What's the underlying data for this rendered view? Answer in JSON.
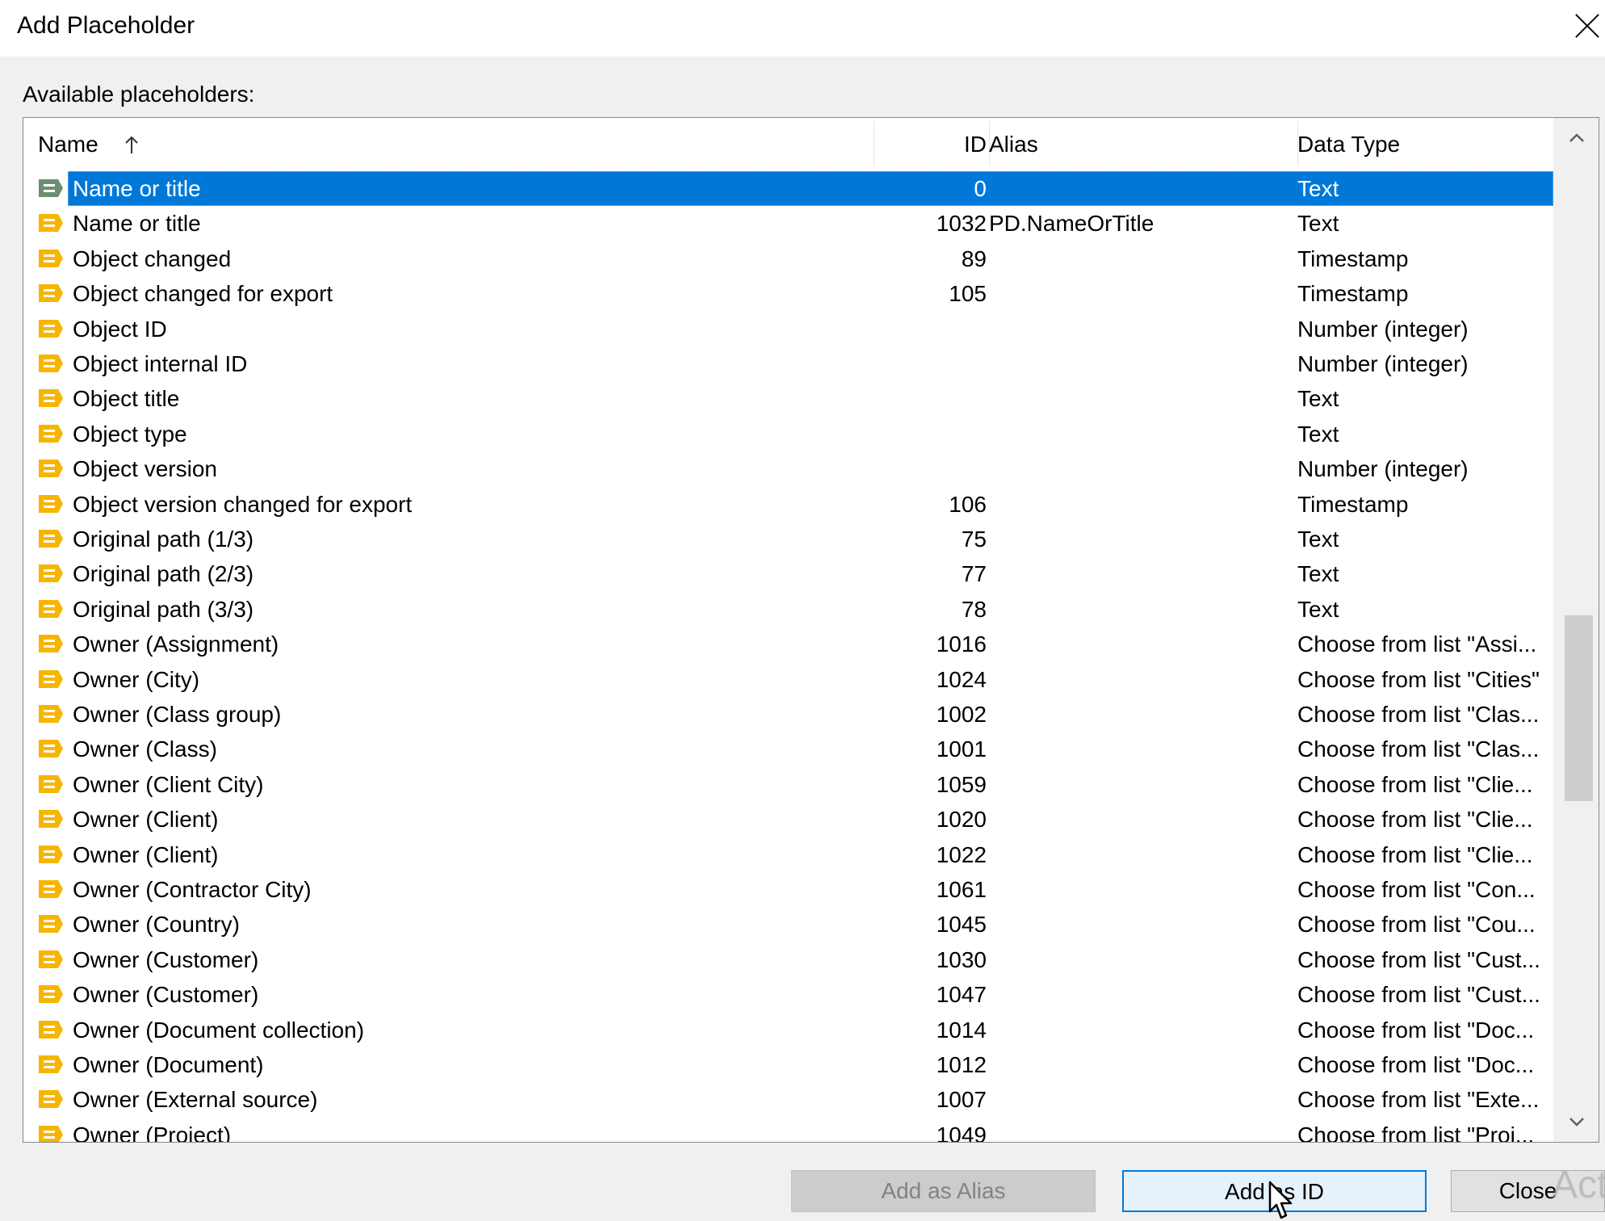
{
  "window": {
    "title": "Add Placeholder"
  },
  "section_label": "Available placeholders:",
  "columns": {
    "name": "Name",
    "id": "ID",
    "alias": "Alias",
    "data_type": "Data Type"
  },
  "icons": {
    "selected_row": "placeholder-grey-icon",
    "row": "placeholder-orange-icon",
    "sort": "sort-up-arrow-icon"
  },
  "colors": {
    "selection": "#0078d7",
    "icon_orange": "#f7b500",
    "icon_grey": "#6b8f70"
  },
  "rows": [
    {
      "name": "Name or title",
      "id": "0",
      "alias": "",
      "data_type": "Text",
      "selected": true
    },
    {
      "name": "Name or title",
      "id": "1032",
      "alias": "PD.NameOrTitle",
      "data_type": "Text"
    },
    {
      "name": "Object changed",
      "id": "89",
      "alias": "",
      "data_type": "Timestamp"
    },
    {
      "name": "Object changed for export",
      "id": "105",
      "alias": "",
      "data_type": "Timestamp"
    },
    {
      "name": "Object ID",
      "id": "",
      "alias": "",
      "data_type": "Number (integer)"
    },
    {
      "name": "Object internal ID",
      "id": "",
      "alias": "",
      "data_type": "Number (integer)"
    },
    {
      "name": "Object title",
      "id": "",
      "alias": "",
      "data_type": "Text"
    },
    {
      "name": "Object type",
      "id": "",
      "alias": "",
      "data_type": "Text"
    },
    {
      "name": "Object version",
      "id": "",
      "alias": "",
      "data_type": "Number (integer)"
    },
    {
      "name": "Object version changed for export",
      "id": "106",
      "alias": "",
      "data_type": "Timestamp"
    },
    {
      "name": "Original path (1/3)",
      "id": "75",
      "alias": "",
      "data_type": "Text"
    },
    {
      "name": "Original path (2/3)",
      "id": "77",
      "alias": "",
      "data_type": "Text"
    },
    {
      "name": "Original path (3/3)",
      "id": "78",
      "alias": "",
      "data_type": "Text"
    },
    {
      "name": "Owner (Assignment)",
      "id": "1016",
      "alias": "",
      "data_type": "Choose from list \"Assi..."
    },
    {
      "name": "Owner (City)",
      "id": "1024",
      "alias": "",
      "data_type": "Choose from list \"Cities\""
    },
    {
      "name": "Owner (Class group)",
      "id": "1002",
      "alias": "",
      "data_type": "Choose from list \"Clas..."
    },
    {
      "name": "Owner (Class)",
      "id": "1001",
      "alias": "",
      "data_type": "Choose from list \"Clas..."
    },
    {
      "name": "Owner (Client City)",
      "id": "1059",
      "alias": "",
      "data_type": "Choose from list \"Clie..."
    },
    {
      "name": "Owner (Client)",
      "id": "1020",
      "alias": "",
      "data_type": "Choose from list \"Clie..."
    },
    {
      "name": "Owner (Client)",
      "id": "1022",
      "alias": "",
      "data_type": "Choose from list \"Clie..."
    },
    {
      "name": "Owner (Contractor City)",
      "id": "1061",
      "alias": "",
      "data_type": "Choose from list \"Con..."
    },
    {
      "name": "Owner (Country)",
      "id": "1045",
      "alias": "",
      "data_type": "Choose from list \"Cou..."
    },
    {
      "name": "Owner (Customer)",
      "id": "1030",
      "alias": "",
      "data_type": "Choose from list \"Cust..."
    },
    {
      "name": "Owner (Customer)",
      "id": "1047",
      "alias": "",
      "data_type": "Choose from list \"Cust..."
    },
    {
      "name": "Owner (Document collection)",
      "id": "1014",
      "alias": "",
      "data_type": "Choose from list \"Doc..."
    },
    {
      "name": "Owner (Document)",
      "id": "1012",
      "alias": "",
      "data_type": "Choose from list \"Doc..."
    },
    {
      "name": "Owner (External source)",
      "id": "1007",
      "alias": "",
      "data_type": "Choose from list \"Exte..."
    },
    {
      "name": "Owner (Project)",
      "id": "1049",
      "alias": "",
      "data_type": "Choose from list \"Proj..."
    }
  ],
  "buttons": {
    "add_as_alias": {
      "label": "Add as Alias",
      "enabled": false
    },
    "add_as_id": {
      "label": "Add as ID",
      "enabled": true,
      "focused": true
    },
    "close": {
      "label": "Close",
      "enabled": true
    }
  },
  "watermark": "Acti"
}
